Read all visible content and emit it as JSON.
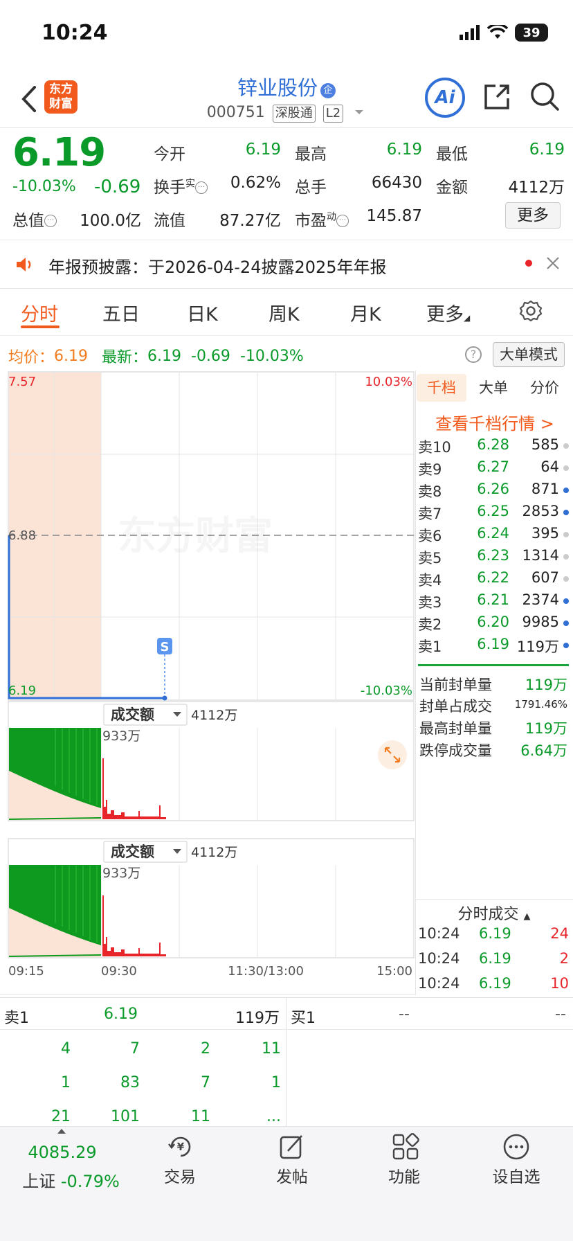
{
  "status_bar": {
    "time": "10:24",
    "battery": "39"
  },
  "header": {
    "logo_line1": "东方",
    "logo_line2": "财富",
    "stock_name": "锌业股份",
    "qi_badge": "企",
    "stock_code": "000751",
    "tag1": "深股通",
    "tag2": "L2",
    "ai_label": "Ai"
  },
  "quote": {
    "price": "6.19",
    "change_pct": "-10.03%",
    "change": "-0.69",
    "fields": [
      {
        "label": "今开",
        "value": "6.19",
        "color": "green"
      },
      {
        "label": "最高",
        "value": "6.19",
        "color": "green"
      },
      {
        "label": "最低",
        "value": "6.19",
        "color": "green"
      },
      {
        "label": "换手",
        "sup": "实",
        "value": "0.62%",
        "color": "black"
      },
      {
        "label": "总手",
        "value": "66430",
        "color": "black"
      },
      {
        "label": "金额",
        "value": "4112万",
        "color": "black"
      },
      {
        "label": "总值",
        "value": "100.0亿",
        "color": "black"
      },
      {
        "label": "流值",
        "value": "87.27亿",
        "color": "black"
      },
      {
        "label": "市盈",
        "sup": "动",
        "value": "145.87",
        "color": "black"
      }
    ],
    "more_label": "更多"
  },
  "announcement": "年报预披露：于2026-04-24披露2025年年报",
  "tabs": [
    "分时",
    "五日",
    "日K",
    "周K",
    "月K",
    "更多"
  ],
  "info_line": {
    "avg_label": "均价：",
    "avg_value": "6.19",
    "latest_label": "最新：",
    "latest_value": "6.19",
    "latest_change": "-0.69",
    "latest_pct": "-10.03%",
    "help": "?",
    "mode_button": "大单模式"
  },
  "chart_data": {
    "type": "line",
    "price_axis": {
      "top": "7.57",
      "mid": "6.88",
      "bottom": "6.19"
    },
    "pct_axis": {
      "top": "10.03%",
      "bottom": "-10.03%"
    },
    "watermark": "东方财富",
    "marker": "S",
    "x_ticks": [
      "09:15",
      "09:30",
      "11:30/13:00",
      "15:00"
    ],
    "volume_panels": [
      {
        "selector": "成交额",
        "total": "4112万",
        "max": "933万"
      },
      {
        "selector": "成交额",
        "total": "4112万",
        "max": "933万"
      }
    ]
  },
  "right_panel": {
    "tabs": [
      "千档",
      "大单",
      "分价"
    ],
    "qiandang_link": "查看千档行情 >",
    "asks": [
      {
        "label": "卖10",
        "price": "6.28",
        "volume": "585",
        "dot": "#cccccc"
      },
      {
        "label": "卖9",
        "price": "6.27",
        "volume": "64",
        "dot": "#cccccc"
      },
      {
        "label": "卖8",
        "price": "6.26",
        "volume": "871",
        "dot": "#2f6fd6"
      },
      {
        "label": "卖7",
        "price": "6.25",
        "volume": "2853",
        "dot": "#2f6fd6"
      },
      {
        "label": "卖6",
        "price": "6.24",
        "volume": "395",
        "dot": "#cccccc"
      },
      {
        "label": "卖5",
        "price": "6.23",
        "volume": "1314",
        "dot": "#cccccc"
      },
      {
        "label": "卖4",
        "price": "6.22",
        "volume": "607",
        "dot": "#cccccc"
      },
      {
        "label": "卖3",
        "price": "6.21",
        "volume": "2374",
        "dot": "#2f6fd6"
      },
      {
        "label": "卖2",
        "price": "6.20",
        "volume": "9985",
        "dot": "#2f6fd6"
      },
      {
        "label": "卖1",
        "price": "6.19",
        "volume": "119万",
        "dot": "#2f6fd6"
      }
    ],
    "stats": [
      {
        "label": "当前封单量",
        "value": "119万"
      },
      {
        "label": "封单占成交",
        "value": "1791.46%"
      },
      {
        "label": "最高封单量",
        "value": "119万"
      },
      {
        "label": "跌停成交量",
        "value": "6.64万"
      }
    ],
    "ticks_title": "分时成交",
    "ticks": [
      {
        "time": "10:24",
        "price": "6.19",
        "volume": "24"
      },
      {
        "time": "10:24",
        "price": "6.19",
        "volume": "2"
      },
      {
        "time": "10:24",
        "price": "6.19",
        "volume": "10"
      }
    ]
  },
  "level1": {
    "sell_label": "卖1",
    "sell_price": "6.19",
    "sell_volume": "119万",
    "buy_label": "买1",
    "buy_price": "--",
    "buy_volume": "--",
    "queue": [
      [
        "4",
        "7",
        "2",
        "11"
      ],
      [
        "1",
        "83",
        "7",
        "1"
      ],
      [
        "21",
        "101",
        "11",
        "..."
      ]
    ]
  },
  "bottom_nav": {
    "index_value": "4085.29",
    "index_name": "上证",
    "index_change": "-0.79%",
    "items": [
      "交易",
      "发帖",
      "功能",
      "设自选"
    ]
  }
}
